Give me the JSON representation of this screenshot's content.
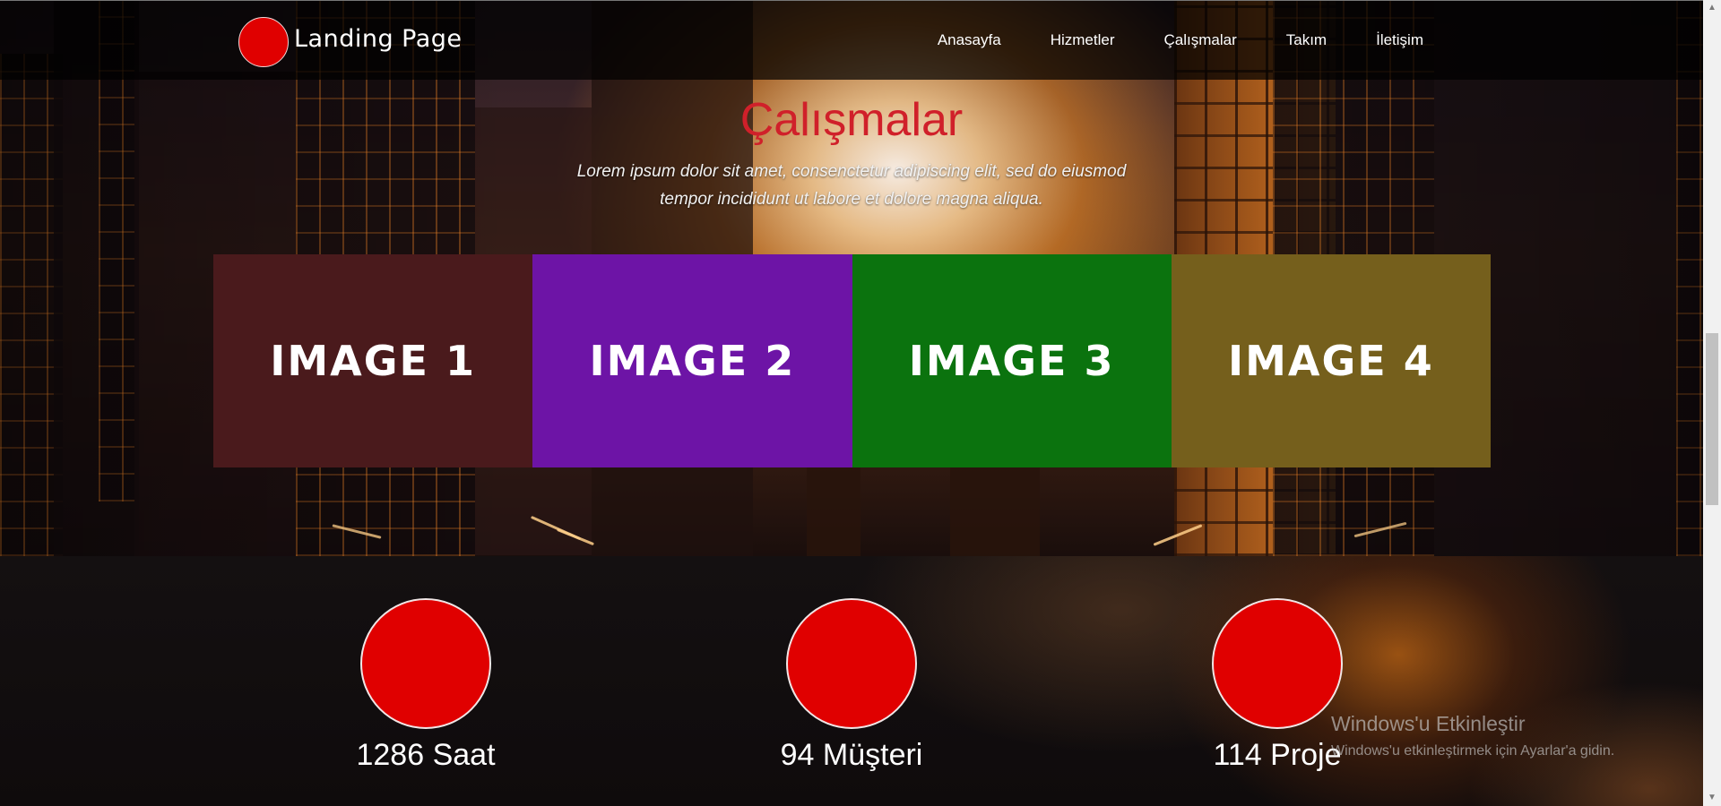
{
  "navbar": {
    "logo_text": "Landing Page",
    "links": [
      "Anasayfa",
      "Hizmetler",
      "Çalışmalar",
      "Takım",
      "İletişim"
    ]
  },
  "works": {
    "title": "Çalışmalar",
    "description": "Lorem ipsum dolor sit amet, consenctetur adipiscing elit, sed do eiusmod tempor incididunt ut labore et dolore magna aliqua.",
    "tiles": [
      {
        "label": "IMAGE 1",
        "color": "#4a1a1c"
      },
      {
        "label": "IMAGE 2",
        "color": "#6d14a6"
      },
      {
        "label": "IMAGE 3",
        "color": "#0b730e"
      },
      {
        "label": "IMAGE 4",
        "color": "#755f1c"
      }
    ]
  },
  "stats": [
    {
      "label": "1286 Saat"
    },
    {
      "label": "94 Müşteri"
    },
    {
      "label": "114 Proje"
    }
  ],
  "watermark": {
    "title": "Windows'u Etkinleştir",
    "subtitle": "Windows'u etkinleştirmek için Ayarlar'a gidin."
  },
  "colors": {
    "accent_red": "#e00000",
    "title_red": "#d0202a"
  }
}
